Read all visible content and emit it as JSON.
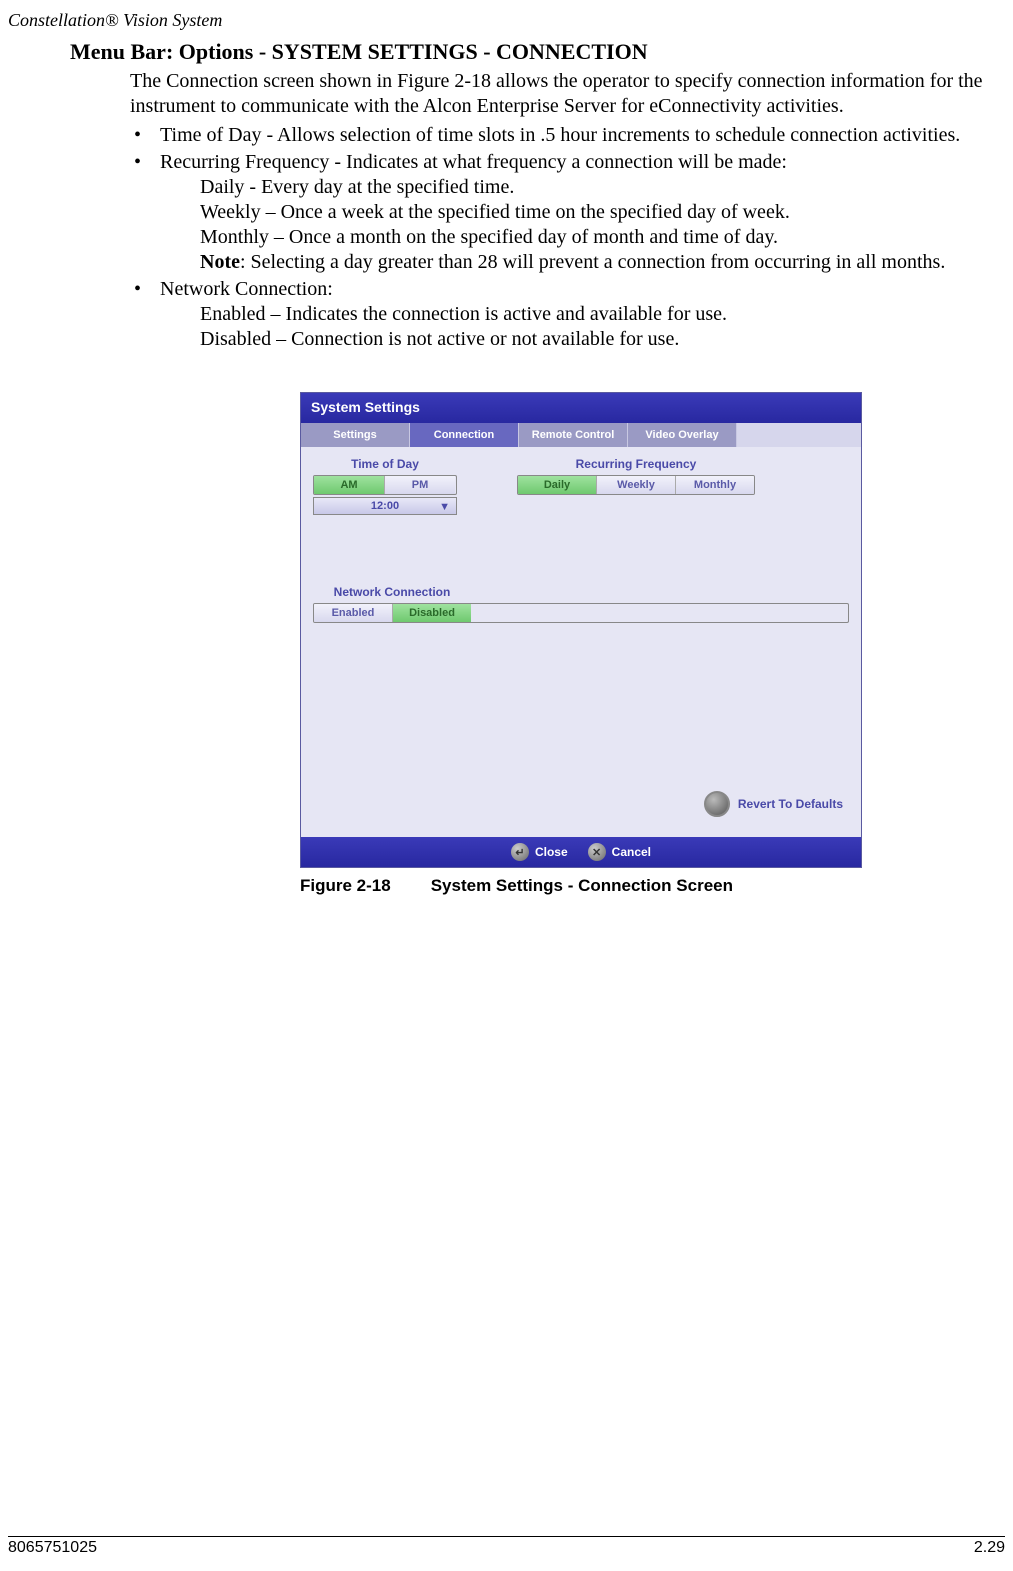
{
  "header": {
    "product": "Constellation® Vision System"
  },
  "title": "Menu Bar: Options - SYSTEM SETTINGS - CONNECTION",
  "intro": "The Connection screen shown in Figure 2-18 allows the operator to specify connection information for the instrument to communicate with the Alcon Enterprise Server for eConnectivity activities.",
  "bullets": {
    "b1": "Time of Day - Allows selection of time slots in .5 hour increments to schedule connection activities.",
    "b2": "Recurring Frequency - Indicates at what frequency a connection will be made:",
    "b2a": "Daily  - Every day at the specified time.",
    "b2b": "Weekly – Once a week at the specified time on the specified day of week.",
    "b2c": "Monthly – Once a month on the specified day of month and time of day.",
    "b2d_note_label": "Note",
    "b2d_note_text": ": Selecting a day greater than 28 will prevent a connection from occurring in all months.",
    "b3": "Network Connection:",
    "b3a": "Enabled – Indicates the connection is active and available for use.",
    "b3b": "Disabled – Connection is not active or not available for use."
  },
  "panel": {
    "title": "System Settings",
    "tabs": {
      "t1": "Settings",
      "t2": "Connection",
      "t3": "Remote Control",
      "t4": "Video Overlay"
    },
    "time_of_day_label": "Time of Day",
    "ampm": {
      "am": "AM",
      "pm": "PM"
    },
    "time_value": "12:00",
    "recurring_label": "Recurring Frequency",
    "freq": {
      "daily": "Daily",
      "weekly": "Weekly",
      "monthly": "Monthly"
    },
    "netconn_label": "Network Connection",
    "net": {
      "enabled": "Enabled",
      "disabled": "Disabled"
    },
    "revert": "Revert To Defaults",
    "close": "Close",
    "cancel": "Cancel"
  },
  "caption": {
    "num": "Figure 2-18",
    "text": "System Settings - Connection Screen"
  },
  "footer": {
    "left": "8065751025",
    "right": "2.29"
  }
}
